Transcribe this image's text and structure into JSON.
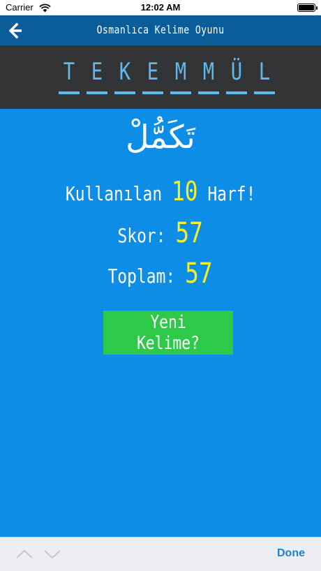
{
  "status_bar": {
    "carrier": "Carrier",
    "time": "12:02 AM",
    "battery_level": 1.0
  },
  "nav": {
    "title": "Osmanlıca Kelime Oyunu"
  },
  "word": {
    "letters": [
      "T",
      "E",
      "K",
      "E",
      "M",
      "M",
      "Ü",
      "L"
    ]
  },
  "main": {
    "arabic": "تَكَمُّلْ",
    "used_prefix": "Kullanılan",
    "used_count": "10",
    "used_suffix": "Harf!",
    "score_label": "Skor:",
    "score_value": "57",
    "total_label": "Toplam:",
    "total_value": "57",
    "new_word_label": "Yeni Kelime?"
  },
  "accessory_bar": {
    "done_label": "Done"
  },
  "colors": {
    "background": "#0d8de6",
    "nav_bar": "#0a5d99",
    "word_panel": "#333436",
    "letter": "#5fb9ef",
    "highlight": "#f5f02a",
    "button": "#2ec949",
    "done": "#1d7fd6"
  },
  "icons": {
    "back": "arrow-left-icon",
    "wifi": "wifi-icon",
    "battery": "battery-icon",
    "prev": "chevron-up-icon",
    "next": "chevron-down-icon"
  }
}
